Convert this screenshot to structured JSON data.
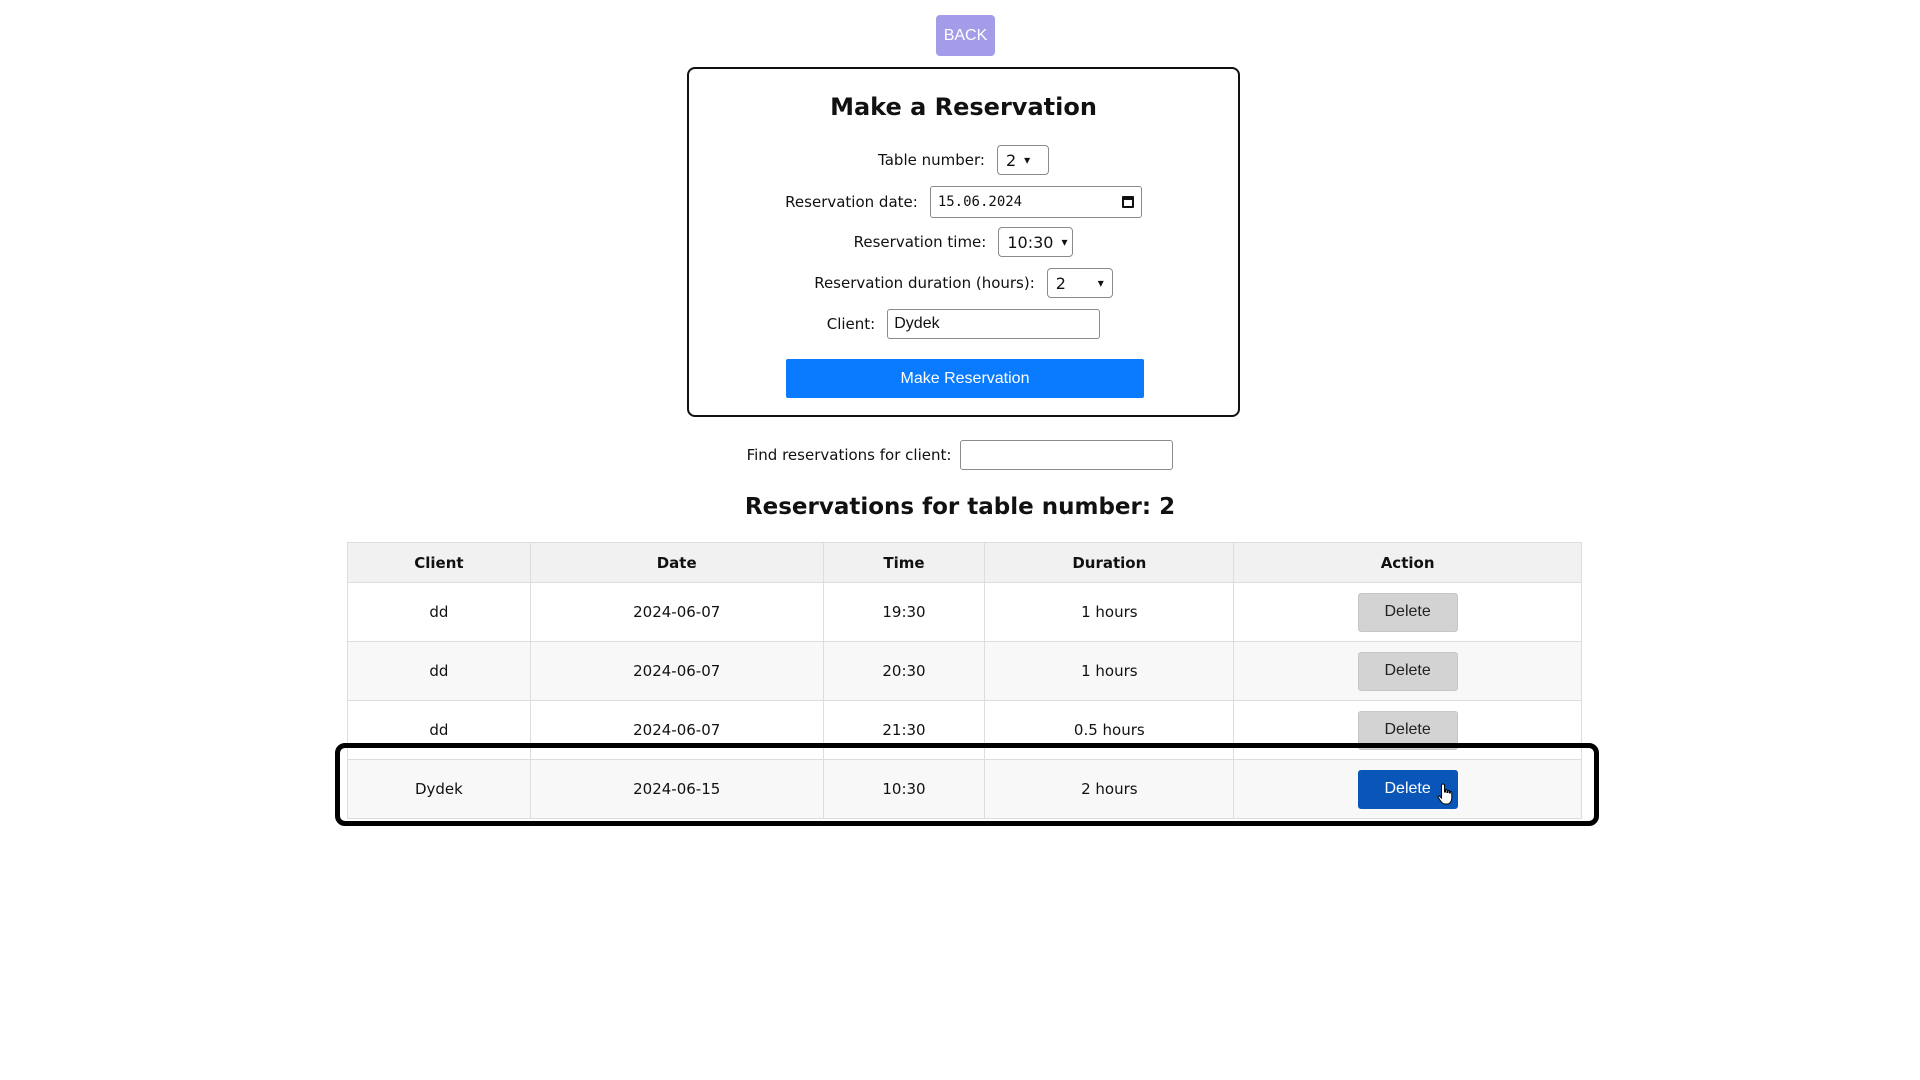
{
  "back_button": {
    "label": "BACK"
  },
  "form": {
    "title": "Make a Reservation",
    "table_number": {
      "label": "Table number:",
      "value": "2"
    },
    "reservation_date": {
      "label": "Reservation date:",
      "value": "15.06.2024"
    },
    "reservation_time": {
      "label": "Reservation time:",
      "value": "10:30"
    },
    "reservation_duration": {
      "label": "Reservation duration (hours):",
      "value": "2"
    },
    "client": {
      "label": "Client:",
      "value": "Dydek"
    },
    "submit_label": "Make Reservation"
  },
  "search": {
    "label": "Find reservations for client:",
    "value": ""
  },
  "reservations": {
    "title": "Reservations for table number: 2",
    "columns": [
      "Client",
      "Date",
      "Time",
      "Duration",
      "Action"
    ],
    "rows": [
      {
        "client": "dd",
        "date": "2024-06-07",
        "time": "19:30",
        "duration": "1 hours",
        "action": "Delete"
      },
      {
        "client": "dd",
        "date": "2024-06-07",
        "time": "20:30",
        "duration": "1 hours",
        "action": "Delete"
      },
      {
        "client": "dd",
        "date": "2024-06-07",
        "time": "21:30",
        "duration": "0.5 hours",
        "action": "Delete"
      },
      {
        "client": "Dydek",
        "date": "2024-06-15",
        "time": "10:30",
        "duration": "2 hours",
        "action": "Delete"
      }
    ]
  },
  "colors": {
    "back_button": "#a39ce8",
    "primary": "#0a7bff",
    "delete_active": "#0a56b8",
    "delete_default": "#d3d3d3"
  }
}
